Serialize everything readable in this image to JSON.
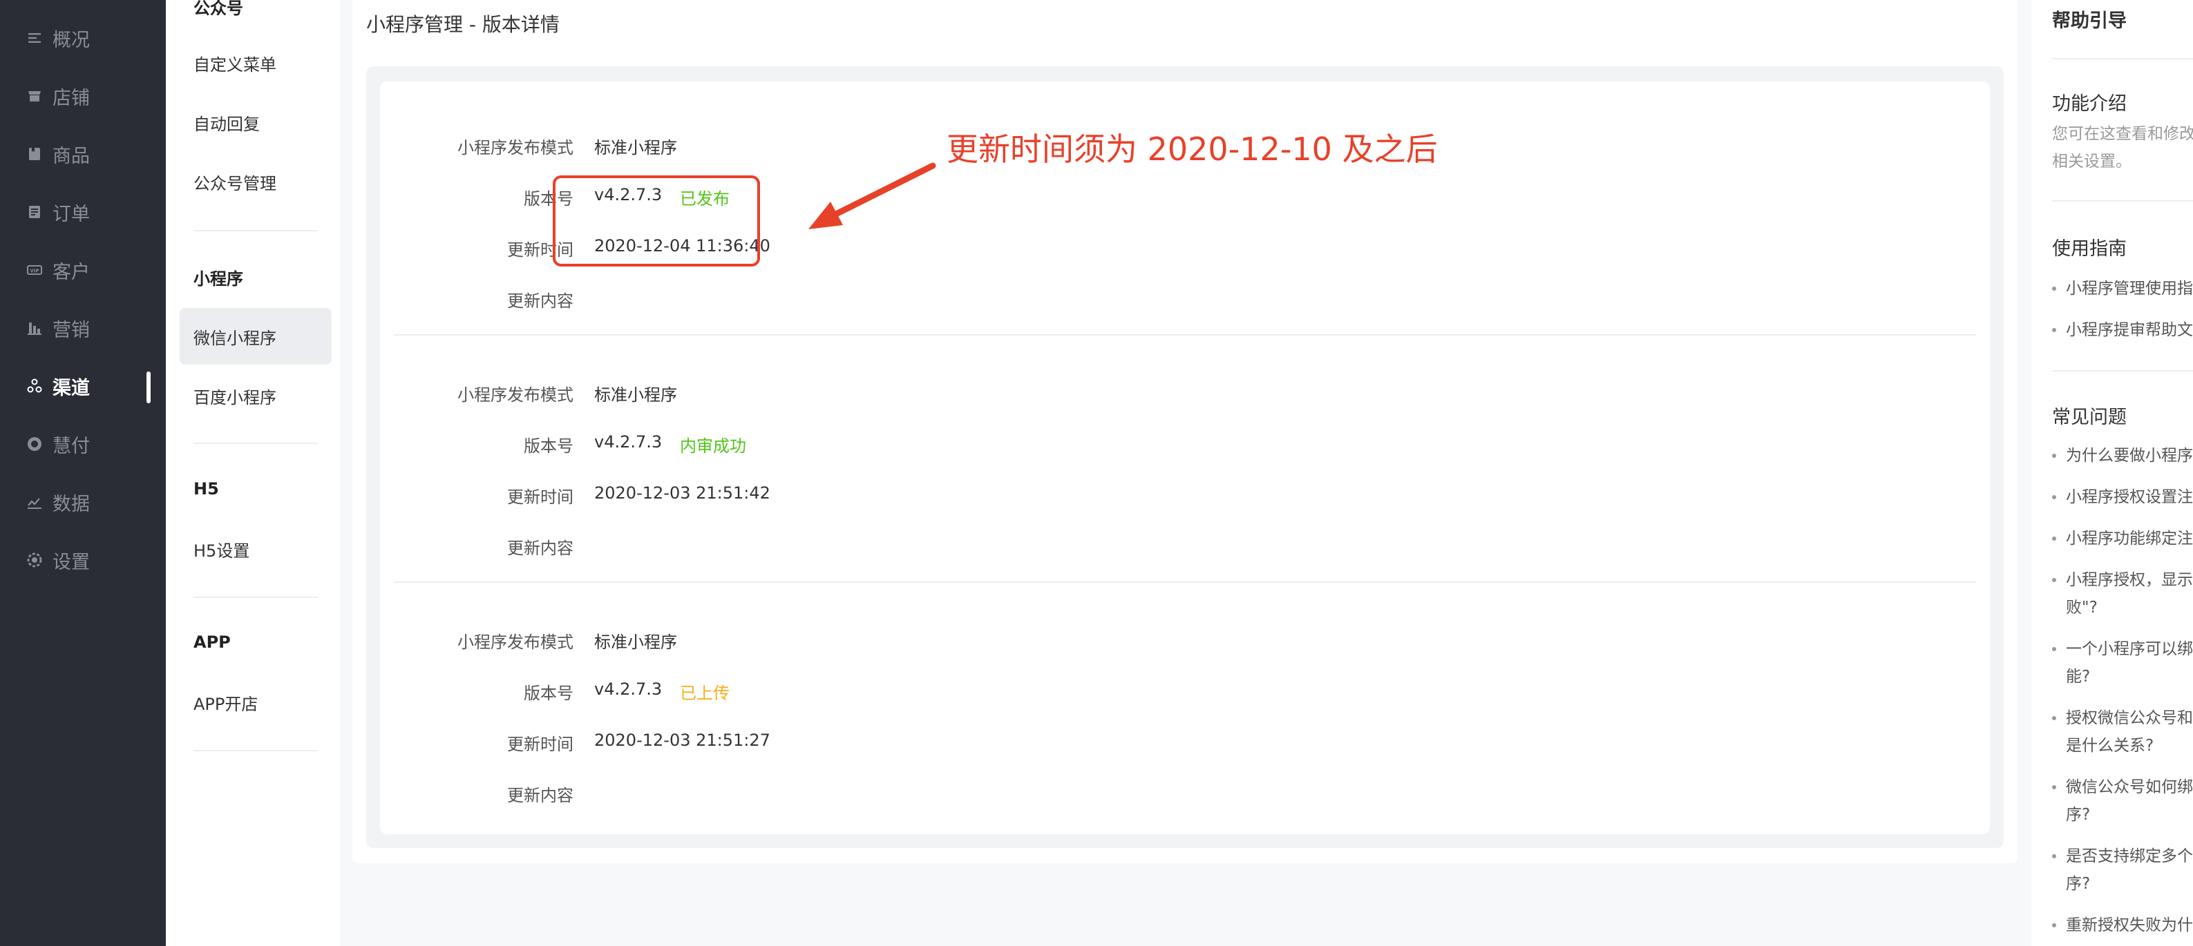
{
  "nav": {
    "items": [
      {
        "label": "概况",
        "icon": "overview-icon"
      },
      {
        "label": "店铺",
        "icon": "store-icon"
      },
      {
        "label": "商品",
        "icon": "goods-icon"
      },
      {
        "label": "订单",
        "icon": "order-icon"
      },
      {
        "label": "客户",
        "icon": "customer-icon"
      },
      {
        "label": "营销",
        "icon": "marketing-icon"
      },
      {
        "label": "渠道",
        "icon": "channel-icon"
      },
      {
        "label": "慧付",
        "icon": "pay-icon"
      },
      {
        "label": "数据",
        "icon": "data-icon"
      },
      {
        "label": "设置",
        "icon": "settings-icon"
      }
    ],
    "active": "渠道"
  },
  "subnav": {
    "sections": [
      {
        "title": "公众号",
        "items": [
          "自定义菜单",
          "自动回复",
          "公众号管理"
        ]
      },
      {
        "title": "小程序",
        "items": [
          "微信小程序",
          "百度小程序"
        ]
      },
      {
        "title": "H5",
        "items": [
          "H5设置"
        ]
      },
      {
        "title": "APP",
        "items": [
          "APP开店"
        ]
      }
    ],
    "active": "微信小程序"
  },
  "main": {
    "title": "小程序管理 - 版本详情",
    "labels": {
      "mode": "小程序发布模式",
      "version": "版本号",
      "time": "更新时间",
      "content": "更新内容"
    },
    "versions": [
      {
        "mode": "标准小程序",
        "version": "v4.2.7.3",
        "status": "已发布",
        "status_color": "#52c41a",
        "time": "2020-12-04 11:36:40",
        "content": ""
      },
      {
        "mode": "标准小程序",
        "version": "v4.2.7.3",
        "status": "内审成功",
        "status_color": "#52c41a",
        "time": "2020-12-03 21:51:42",
        "content": ""
      },
      {
        "mode": "标准小程序",
        "version": "v4.2.7.3",
        "status": "已上传",
        "status_color": "#faad14",
        "time": "2020-12-03 21:51:27",
        "content": ""
      }
    ]
  },
  "annotation": {
    "text": "更新时间须为 2020-12-10 及之后",
    "color": "#e8412a"
  },
  "help": {
    "title": "帮助引导",
    "intro_title": "功能介绍",
    "intro_lines": [
      "您可在这查看和修改",
      "相关设置。"
    ],
    "guide_title": "使用指南",
    "guide_links": [
      "小程序管理使用指南",
      "小程序提审帮助文档"
    ],
    "faq_title": "常见问题",
    "faq_links": [
      [
        "为什么要做小程序"
      ],
      [
        "小程序授权设置注意"
      ],
      [
        "小程序功能绑定注意"
      ],
      [
        "小程序授权，显示",
        "败\"?"
      ],
      [
        "一个小程序可以绑",
        "能?"
      ],
      [
        "授权微信公众号和",
        "是什么关系?"
      ],
      [
        "微信公众号如何绑",
        "序?"
      ],
      [
        "是否支持绑定多个",
        "序?"
      ],
      [
        "重新授权失败为什"
      ]
    ]
  }
}
